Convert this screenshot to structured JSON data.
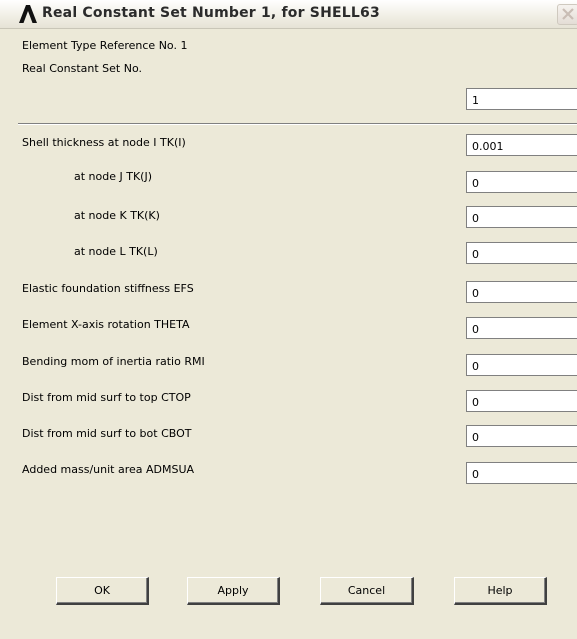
{
  "window": {
    "title": "Real Constant Set Number 1, for SHELL63",
    "logo_icon": "ansys-logo-icon",
    "close_icon": "close-icon"
  },
  "header": {
    "element_type_ref": "Element Type Reference No. 1",
    "real_constant_set_label": "Real Constant Set No.",
    "real_constant_set_value": "1"
  },
  "fields": [
    {
      "label": "Shell thickness at node I  TK(I)",
      "value": "0.001"
    },
    {
      "label": "at node J  TK(J)",
      "value": "0"
    },
    {
      "label": "at node K  TK(K)",
      "value": "0"
    },
    {
      "label": "at node L  TK(L)",
      "value": "0"
    },
    {
      "label": "Elastic foundation stiffness EFS",
      "value": "0"
    },
    {
      "label": "Element X-axis rotation    THETA",
      "value": "0"
    },
    {
      "label": "Bending mom of inertia ratio RMI",
      "value": "0"
    },
    {
      "label": "Dist from mid surf to top   CTOP",
      "value": "0"
    },
    {
      "label": "Dist from mid surf to bot   CBOT",
      "value": "0"
    },
    {
      "label": "Added mass/unit area      ADMSUA",
      "value": "0"
    }
  ],
  "buttons": {
    "ok": "OK",
    "apply": "Apply",
    "cancel": "Cancel",
    "help": "Help"
  },
  "colors": {
    "dialog_bg": "#ece9d8",
    "logo_color": "#111111"
  }
}
